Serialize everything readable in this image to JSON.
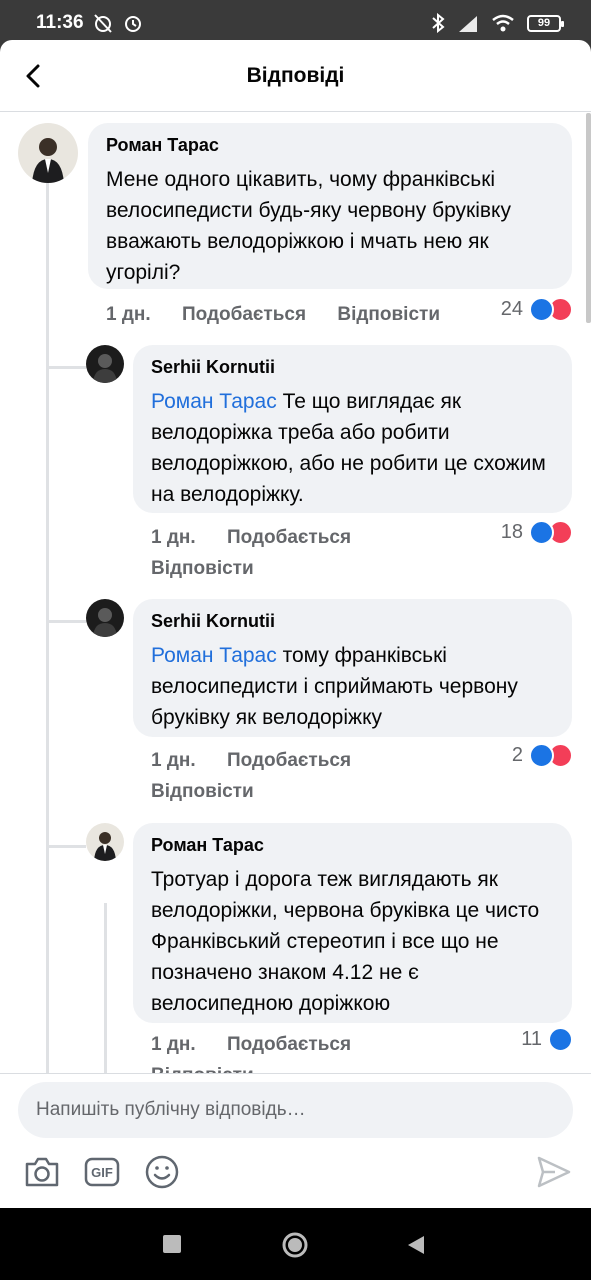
{
  "status_bar": {
    "time": "11:36",
    "battery": "99"
  },
  "header": {
    "title": "Відповіді"
  },
  "comments": [
    {
      "author": "Роман Тарас",
      "mention": "",
      "text": "Мене одного цікавить, чому франківські велосипедисти будь-яку червону бруківку вважають велодоріжкою і мчать нею як угорілі?",
      "time": "1 дн.",
      "like_label": "Подобається",
      "reply_label": "Відповісти",
      "reactions": "24"
    },
    {
      "author": "Serhii Kornutii",
      "mention": "Роман Тарас",
      "text": "Те що виглядає як велодоріжка треба або робити велодоріжкою,  або не робити це схожим на велодоріжку.",
      "time": "1 дн.",
      "like_label": "Подобається",
      "reply_label": "Відповісти",
      "reactions": "18"
    },
    {
      "author": "Serhii Kornutii",
      "mention": "Роман Тарас",
      "text": "тому франківські велосипедисти і сприймають червону бруківку як велодоріжку",
      "time": "1 дн.",
      "like_label": "Подобається",
      "reply_label": "Відповісти",
      "reactions": "2"
    },
    {
      "author": "Роман Тарас",
      "mention": "",
      "text": "Тротуар і дорога теж виглядають як велодоріжки, червона бруківка це чисто Франківський стереотип і все що не позначено знаком 4.12 не є велосипедною доріжкою",
      "time": "1 дн.",
      "like_label": "Подобається",
      "reply_label": "Відповісти",
      "reactions": "11"
    }
  ],
  "composer": {
    "placeholder": "Напишіть публічну відповідь…",
    "gif_label": "GIF"
  },
  "colors": {
    "accent": "#1b74e4",
    "mention": "#216fdb",
    "love": "#f33e58",
    "bubble": "#f0f2f5"
  }
}
